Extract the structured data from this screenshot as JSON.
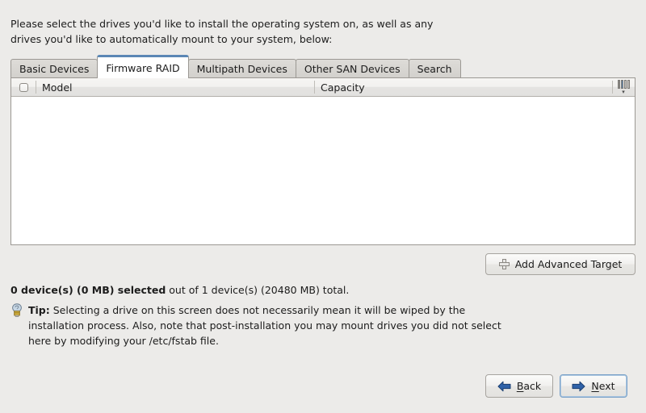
{
  "intro": {
    "text": "Please select the drives you'd like to install the operating system on, as well as any\ndrives you'd like to automatically mount to your system, below:"
  },
  "tabs": [
    {
      "label": "Basic Devices",
      "active": false
    },
    {
      "label": "Firmware RAID",
      "active": true
    },
    {
      "label": "Multipath Devices",
      "active": false
    },
    {
      "label": "Other SAN Devices",
      "active": false
    },
    {
      "label": "Search",
      "active": false
    }
  ],
  "table": {
    "select_all_checkbox": "unchecked",
    "columns": [
      {
        "label": "Model"
      },
      {
        "label": "Capacity"
      }
    ],
    "column_chooser_icon": "columns-icon",
    "column_chooser_arrow": "▾",
    "rows": []
  },
  "toolbar": {
    "add_target_label": "Add Advanced Target",
    "add_target_icon": "plus-icon"
  },
  "status": {
    "selected_text": "0 device(s) (0 MB) selected",
    "total_text": " out of 1 device(s) (20480 MB) total."
  },
  "tip": {
    "icon": "lightbulb-icon",
    "label": "Tip:",
    "text": " Selecting a drive on this screen does not necessarily mean it will be wiped by the installation process.  Also, note that post-installation you may mount drives you did not select here by modifying your /etc/fstab file."
  },
  "nav": {
    "back": {
      "prefix": "",
      "mnemonic": "B",
      "suffix": "ack",
      "icon": "arrow-left-icon"
    },
    "next": {
      "prefix": "",
      "mnemonic": "N",
      "suffix": "ext",
      "icon": "arrow-right-icon",
      "focused": true
    }
  },
  "colors": {
    "background": "#ecebe9",
    "accent_blue": "#5b87b5",
    "arrow_blue": "#2f62a8",
    "table_background": "#ffffff",
    "border": "#9b9893"
  }
}
